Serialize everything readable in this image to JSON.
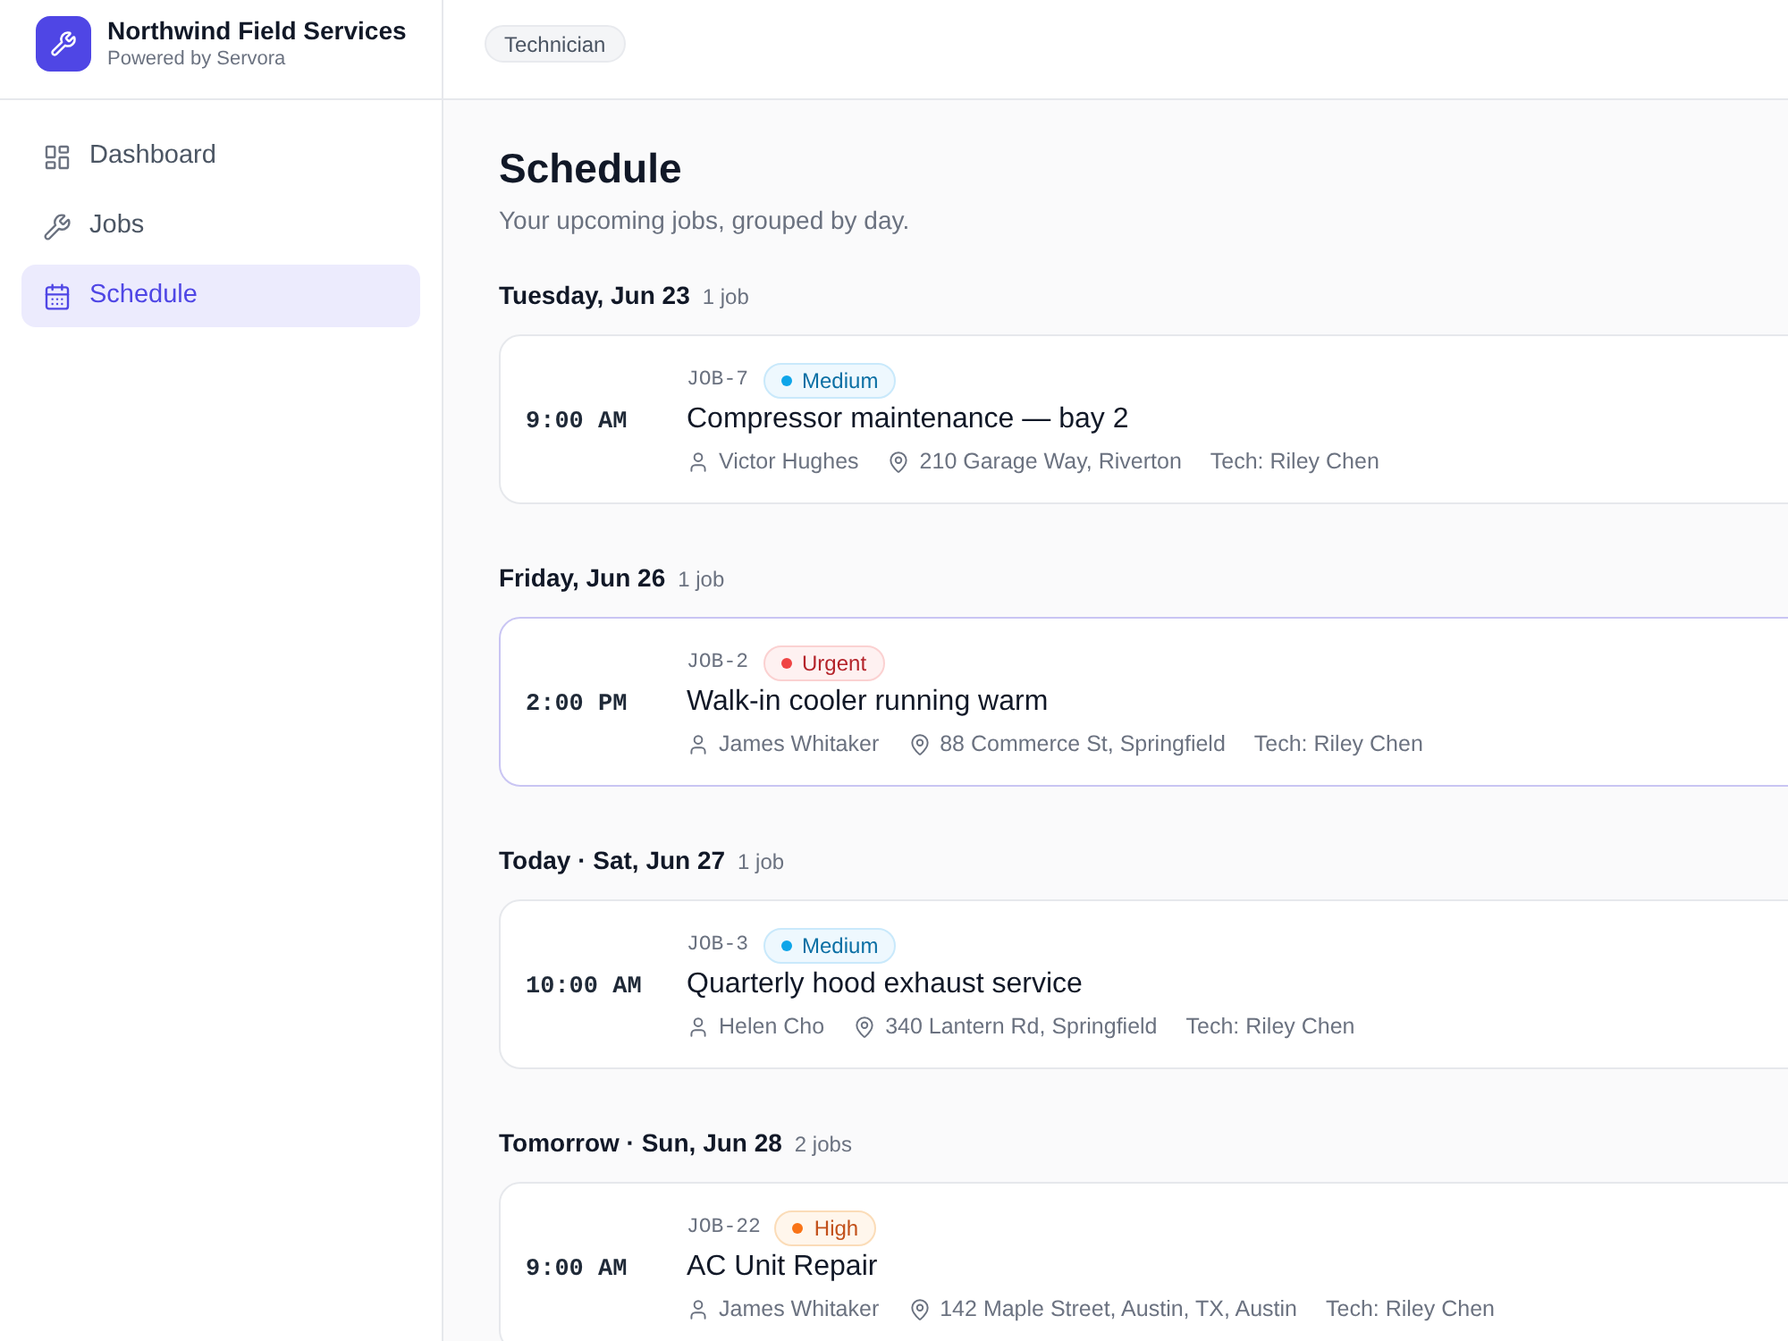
{
  "sidebar": {
    "brand": {
      "name": "Northwind Field Services",
      "tagline": "Powered by Servora"
    },
    "nav": [
      {
        "label": "Dashboard",
        "selected": false
      },
      {
        "label": "Jobs",
        "selected": false
      },
      {
        "label": "Schedule",
        "selected": true
      }
    ]
  },
  "header": {
    "role_badge": "Technician"
  },
  "page": {
    "title": "Schedule",
    "subtitle": "Your upcoming jobs, grouped by day."
  },
  "days": [
    {
      "heading": "Tuesday, Jun 23",
      "count": "1 job",
      "jobs": [
        {
          "time": "9:00 AM",
          "id": "JOB-7",
          "priority": {
            "label": "Medium",
            "kind": "medium",
            "color": "#0ea5e9"
          },
          "title": "Compressor maintenance — bay 2",
          "customer": "Victor Hughes",
          "address": "210 Garage Way, Riverton",
          "tech": "Tech: Riley Chen",
          "hovered": false
        }
      ]
    },
    {
      "heading": "Friday, Jun 26",
      "count": "1 job",
      "jobs": [
        {
          "time": "2:00 PM",
          "id": "JOB-2",
          "priority": {
            "label": "Urgent",
            "kind": "urgent",
            "color": "#ef4444"
          },
          "title": "Walk-in cooler running warm",
          "customer": "James Whitaker",
          "address": "88 Commerce St, Springfield",
          "tech": "Tech: Riley Chen",
          "hovered": true
        }
      ]
    },
    {
      "heading": "Today · Sat, Jun 27",
      "count": "1 job",
      "jobs": [
        {
          "time": "10:00 AM",
          "id": "JOB-3",
          "priority": {
            "label": "Medium",
            "kind": "medium",
            "color": "#0ea5e9"
          },
          "title": "Quarterly hood exhaust service",
          "customer": "Helen Cho",
          "address": "340 Lantern Rd, Springfield",
          "tech": "Tech: Riley Chen",
          "hovered": false
        }
      ]
    },
    {
      "heading": "Tomorrow · Sun, Jun 28",
      "count": "2 jobs",
      "jobs": [
        {
          "time": "9:00 AM",
          "id": "JOB-22",
          "priority": {
            "label": "High",
            "kind": "high",
            "color": "#f97316"
          },
          "title": "AC Unit Repair",
          "customer": "James Whitaker",
          "address": "142 Maple Street, Austin, TX, Austin",
          "tech": "Tech: Riley Chen",
          "hovered": false
        }
      ]
    }
  ]
}
